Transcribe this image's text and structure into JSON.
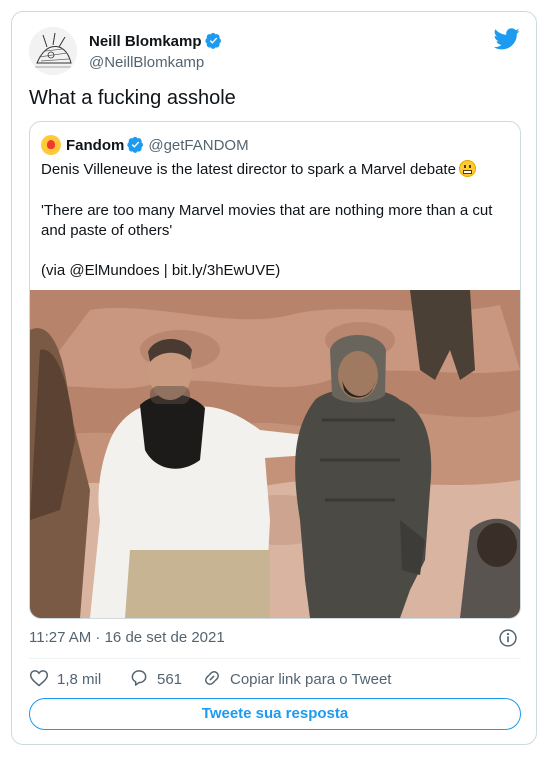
{
  "author": {
    "name": "Neill Blomkamp",
    "handle": "@NeillBlomkamp",
    "avatar_icon": "sketch-avatar",
    "verified": true
  },
  "brand_icon": "twitter-bird-icon",
  "tweet": {
    "text": "What a fucking asshole"
  },
  "quoted": {
    "name": "Fandom",
    "handle": "@getFANDOM",
    "logo_icon": "fandom-logo-icon",
    "lines": [
      "Denis Villeneuve is the latest director to spark a Marvel debate",
      "'There are too many Marvel movies that are nothing more than a cut",
      "and paste of others'",
      "(via @ElMundoes | bit.ly/3hEwUVE)"
    ],
    "emoji": "grimacing-face-emoji"
  },
  "meta": {
    "timestamp": "11:27 AM · 16 de set de 2021"
  },
  "actions": {
    "likes": "1,8 mil",
    "replies": "561",
    "copy_link": "Copiar link para o Tweet"
  },
  "reply_button": "Tweete sua resposta",
  "colors": {
    "accent": "#1d9bf0",
    "text": "#0f1419",
    "muted": "#536471",
    "border": "#cfd9de"
  }
}
